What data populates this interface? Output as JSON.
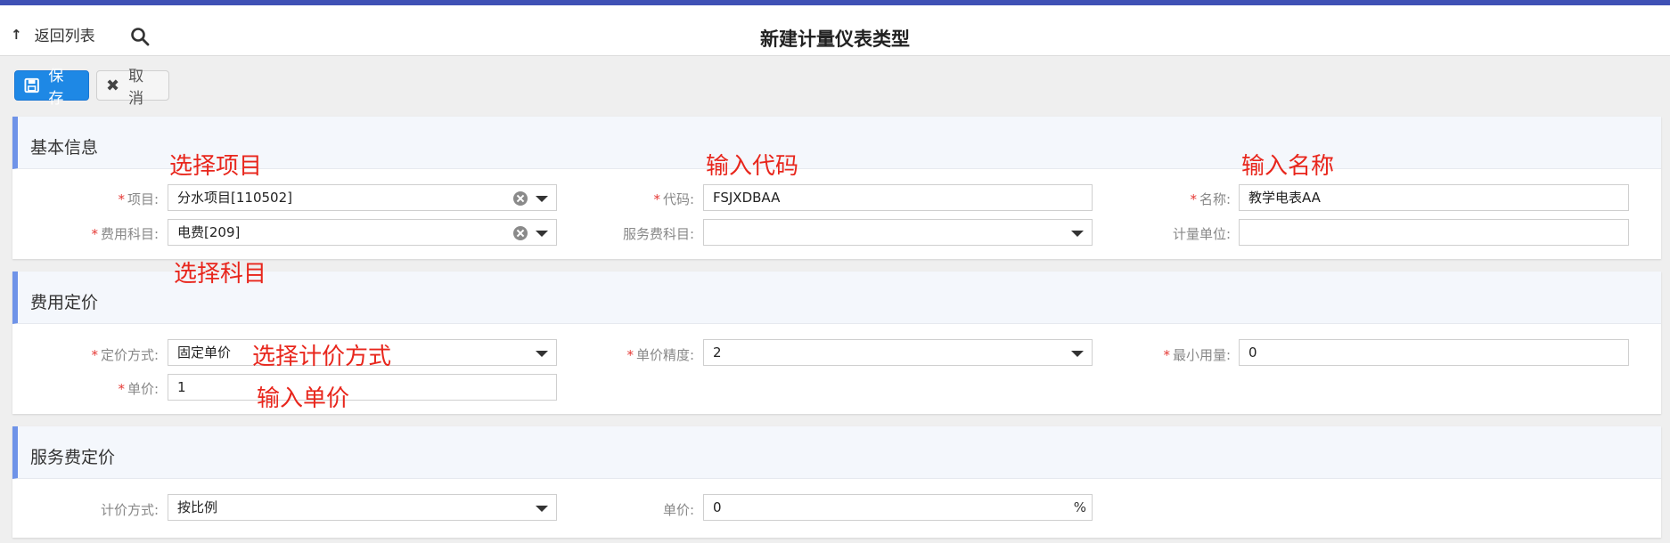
{
  "header": {
    "back_label": "返回列表",
    "title": "新建计量仪表类型"
  },
  "toolbar": {
    "save_label": "保存",
    "cancel_label": "取消"
  },
  "sections": {
    "basic": {
      "title": "基本信息",
      "project_label": "项目:",
      "project_value": "分水项目[110502]",
      "code_label": "代码:",
      "code_value": "FSJXDBAA",
      "name_label": "名称:",
      "name_value": "教学电表AA",
      "subject_label": "费用科目:",
      "subject_value": "电费[209]",
      "service_subject_label": "服务费科目:",
      "service_subject_value": "",
      "unit_label": "计量单位:",
      "unit_value": ""
    },
    "pricing": {
      "title": "费用定价",
      "method_label": "定价方式:",
      "method_value": "固定单价",
      "precision_label": "单价精度:",
      "precision_value": "2",
      "min_label": "最小用量:",
      "min_value": "0",
      "price_label": "单价:",
      "price_value": "1"
    },
    "service": {
      "title": "服务费定价",
      "method_label": "计价方式:",
      "method_value": "按比例",
      "price_label": "单价:",
      "price_value": "0",
      "price_suffix": "%"
    }
  },
  "annotations": {
    "select_project": "选择项目",
    "input_code": "输入代码",
    "input_name": "输入名称",
    "select_subject": "选择科目",
    "select_method": "选择计价方式",
    "input_price": "输入单价"
  },
  "required_mark": "*",
  "colors": {
    "topbar": "#3f51b5",
    "primary": "#1e88e5",
    "required": "#e53935",
    "annotation": "#e8261c",
    "section_accent": "#6f93e8"
  }
}
